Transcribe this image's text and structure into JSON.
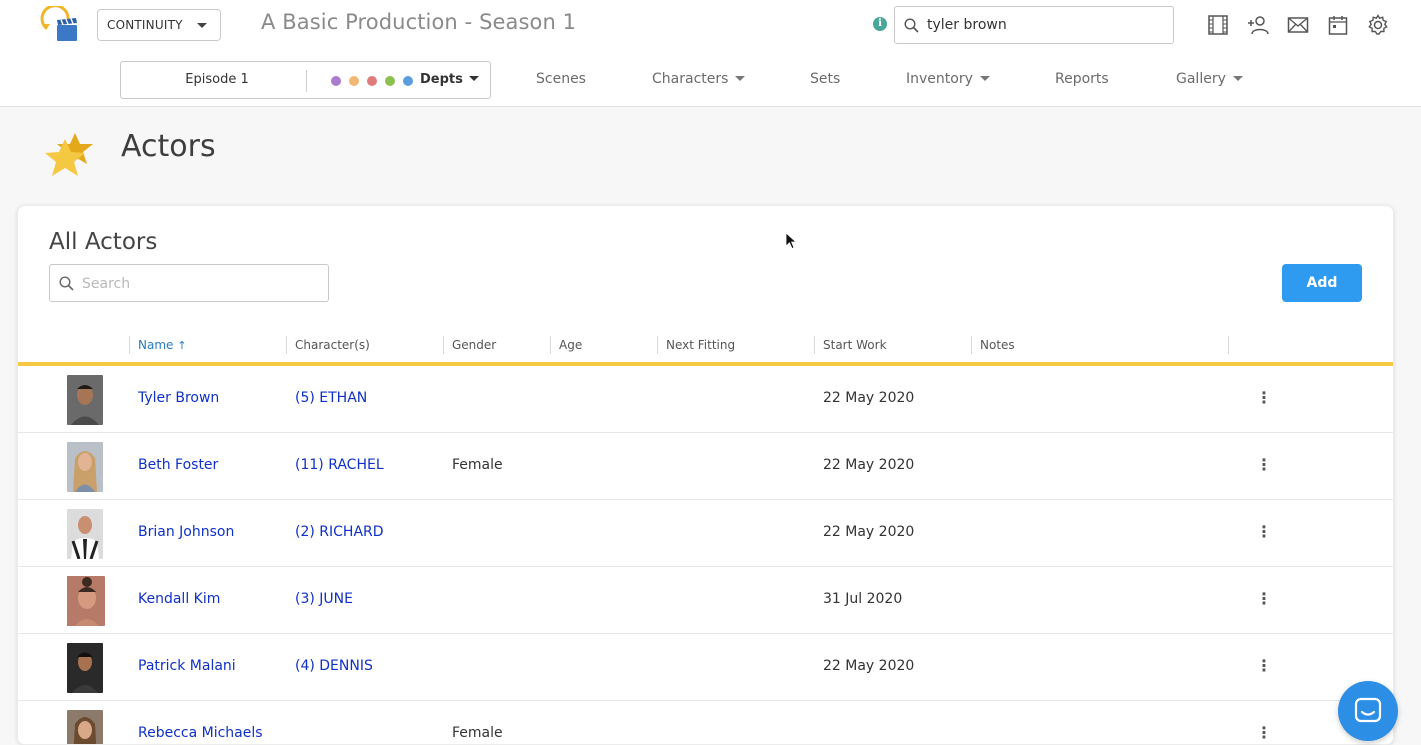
{
  "app": {
    "switcher_label": "CONTINUITY",
    "production_title": "A Basic Production - Season 1",
    "info_icon": "info-icon",
    "search_value": "tyler brown"
  },
  "top_icons": [
    "film-icon",
    "add-user-icon",
    "mail-icon",
    "calendar-icon",
    "gear-icon"
  ],
  "subnav": {
    "episode_label": "Episode 1",
    "dept_dots": [
      "#a97ccf",
      "#f3b774",
      "#e07b7b",
      "#8cc04f",
      "#5b9ee0"
    ],
    "depts_label": "Depts",
    "items": [
      {
        "label": "Scenes",
        "has_caret": false
      },
      {
        "label": "Characters",
        "has_caret": true
      },
      {
        "label": "Sets",
        "has_caret": false
      },
      {
        "label": "Inventory",
        "has_caret": true
      },
      {
        "label": "Reports",
        "has_caret": false
      },
      {
        "label": "Gallery",
        "has_caret": true
      }
    ]
  },
  "page": {
    "title": "Actors",
    "icon": "star-icon"
  },
  "card": {
    "title": "All Actors",
    "search_placeholder": "Search",
    "add_label": "Add"
  },
  "table": {
    "columns": [
      {
        "label": "Name",
        "sorted": true
      },
      {
        "label": "Character(s)",
        "sorted": false
      },
      {
        "label": "Gender",
        "sorted": false
      },
      {
        "label": "Age",
        "sorted": false
      },
      {
        "label": "Next Fitting",
        "sorted": false
      },
      {
        "label": "Start Work",
        "sorted": false
      },
      {
        "label": "Notes",
        "sorted": false
      }
    ],
    "sort_arrow": "↑",
    "rows": [
      {
        "name": "Tyler Brown",
        "characters": "(5) ETHAN",
        "gender": "",
        "start_work": "22 May 2020",
        "avatar_bg": "#6a6a6a",
        "avatar_skin": "#a57555"
      },
      {
        "name": "Beth Foster",
        "characters": "(11) RACHEL",
        "gender": "Female",
        "start_work": "22 May 2020",
        "avatar_bg": "#b9c0c8",
        "avatar_skin": "#e2b494"
      },
      {
        "name": "Brian Johnson",
        "characters": "(2) RICHARD",
        "gender": "",
        "start_work": "22 May 2020",
        "avatar_bg": "#dcdcdc",
        "avatar_skin": "#c89070"
      },
      {
        "name": "Kendall Kim",
        "characters": "(3) JUNE",
        "gender": "",
        "start_work": "31 Jul 2020",
        "avatar_bg": "#b87a68",
        "avatar_skin": "#d69a80"
      },
      {
        "name": "Patrick Malani",
        "characters": "(4) DENNIS",
        "gender": "",
        "start_work": "22 May 2020",
        "avatar_bg": "#2a2a2a",
        "avatar_skin": "#a87250"
      },
      {
        "name": "Rebecca Michaels",
        "characters": "",
        "gender": "Female",
        "start_work": "",
        "avatar_bg": "#8c7a6a",
        "avatar_skin": "#d8a888"
      }
    ]
  },
  "chat_icon": "chat-icon"
}
